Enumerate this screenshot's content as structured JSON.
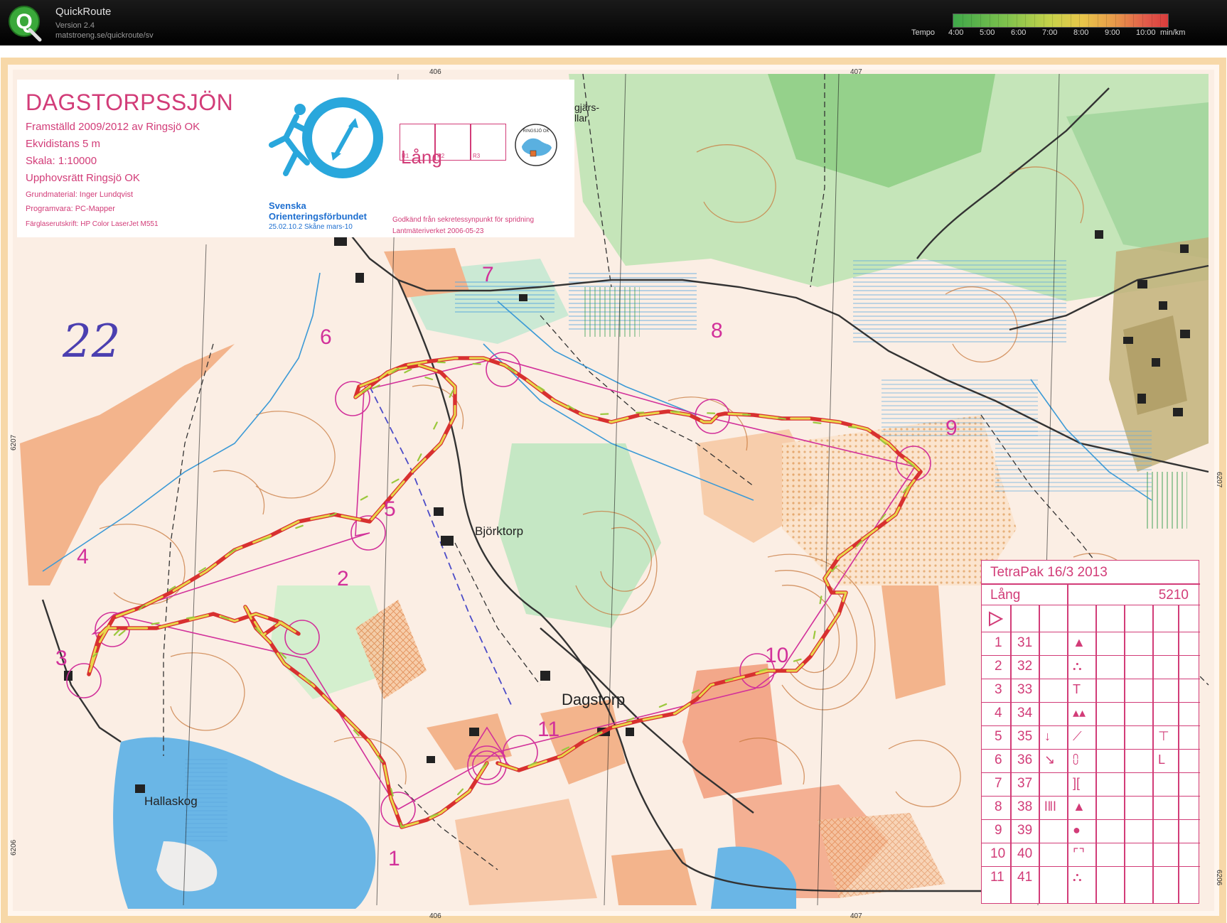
{
  "app": {
    "title": "QuickRoute",
    "version": "Version 2.4",
    "url": "matstroeng.se/quickroute/sv",
    "logo_letter": "Q"
  },
  "tempo": {
    "label": "Tempo",
    "ticks": [
      "4:00",
      "5:00",
      "6:00",
      "7:00",
      "8:00",
      "9:00",
      "10:00"
    ],
    "unit": "min/km"
  },
  "map": {
    "title": "DAGSTORPSSJÖN",
    "info": [
      "Framställd 2009/2012 av Ringsjö OK",
      "Ekvidistans 5 m",
      "Skala:   1:10000",
      "Upphovsrätt Ringsjö OK",
      "Grundmaterial: Inger Lundqvist",
      "Programvara: PC-Mapper",
      "Färglaserutskrift: HP Color LaserJet M551"
    ],
    "federation_line1": "Svenska",
    "federation_line2": "Orienteringsförbundet",
    "federation_code": "25.02.10.2 Skåne mars-10",
    "approval_line1": "Godkänd från sekretessynpunkt för spridning",
    "approval_line2": "Lantmäteriverket 2006-05-23",
    "class": "Lång",
    "result_boxes": [
      "R1",
      "R2",
      "R3"
    ],
    "club_badge": "RINGSJÖ OK",
    "hand_note": "22",
    "grid_top": [
      "406",
      "407"
    ],
    "grid_bottom": [
      "406",
      "407"
    ],
    "grid_left": [
      "6207",
      "6206"
    ],
    "grid_right": [
      "6207",
      "6206"
    ],
    "place_names": [
      "Björktorp",
      "Dagstorp",
      "Hallaskog"
    ],
    "partial_label": "gjärs-\nllar",
    "controls": [
      "1",
      "2",
      "3",
      "4",
      "5",
      "6",
      "7",
      "8",
      "9",
      "10",
      "11"
    ]
  },
  "description_card": {
    "event": "TetraPak 16/3 2013",
    "class": "Lång",
    "length": "5210",
    "rows": [
      {
        "n": "1",
        "code": "31",
        "c": "",
        "d": "▲",
        "g": ""
      },
      {
        "n": "2",
        "code": "32",
        "c": "",
        "d": "⛬",
        "g": ""
      },
      {
        "n": "3",
        "code": "33",
        "c": "",
        "d": "T",
        "g": ""
      },
      {
        "n": "4",
        "code": "34",
        "c": "",
        "d": "▴▴",
        "g": ""
      },
      {
        "n": "5",
        "code": "35",
        "c": "↓",
        "d": "⟋",
        "g": "⊤"
      },
      {
        "n": "6",
        "code": "36",
        "c": "↘",
        "d": "⩇",
        "g": "L"
      },
      {
        "n": "7",
        "code": "37",
        "c": "",
        "d": "][",
        "g": ""
      },
      {
        "n": "8",
        "code": "38",
        "c": "ǀǁǀ",
        "d": "▲",
        "g": ""
      },
      {
        "n": "9",
        "code": "39",
        "c": "",
        "d": "●",
        "g": ""
      },
      {
        "n": "10",
        "code": "40",
        "c": "",
        "d": "⌜⌝",
        "g": ""
      },
      {
        "n": "11",
        "code": "41",
        "c": "",
        "d": "⛬",
        "g": ""
      }
    ]
  },
  "colors": {
    "course": "#d2309a",
    "route_fast": "#e8d84a",
    "route_slow": "#d83030",
    "water": "#6ab6e6",
    "open": "#f3b48c",
    "forest_green": "#8fd08a",
    "contour": "#c8783c"
  }
}
